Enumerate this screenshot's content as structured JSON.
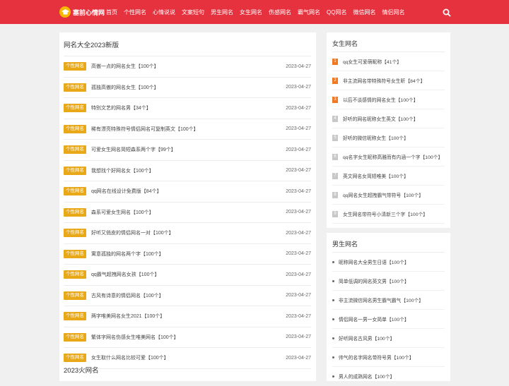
{
  "site": {
    "logo_text": "塞前心情网"
  },
  "nav": [
    "首页",
    "个性网名",
    "心情说说",
    "文案短句",
    "男生网名",
    "女生网名",
    "伤感网名",
    "霸气网名",
    "QQ网名",
    "微信网名",
    "情侣网名"
  ],
  "main": {
    "title": "网名大全2023新版",
    "tag": "个性网名",
    "rows": [
      {
        "title": "高傲一点的网名女生【100个】",
        "date": "2023-04-27"
      },
      {
        "title": "孤独高傲的网名女生【100个】",
        "date": "2023-04-27"
      },
      {
        "title": "特别文艺的网名男【34个】",
        "date": "2023-04-27"
      },
      {
        "title": "稀有漂亮特殊符号情侣网名可复制英文【100个】",
        "date": "2023-04-27"
      },
      {
        "title": "可爱女生网名简短森系两个字【99个】",
        "date": "2023-04-27"
      },
      {
        "title": "我想找个好网名女【100个】",
        "date": "2023-04-27"
      },
      {
        "title": "qq网名在线设计免费版【84个】",
        "date": "2023-04-27"
      },
      {
        "title": "森系可爱女生网名【100个】",
        "date": "2023-04-27"
      },
      {
        "title": "好听又俏皮的情侣网名一对【100个】",
        "date": "2023-04-27"
      },
      {
        "title": "寓意孤独的网名两个字【100个】",
        "date": "2023-04-27"
      },
      {
        "title": "qq霸气超拽网名女孩【100个】",
        "date": "2023-04-27"
      },
      {
        "title": "古风有诗意的情侣网名【100个】",
        "date": "2023-04-27"
      },
      {
        "title": "两字唯美网名女生2021【100个】",
        "date": "2023-04-27"
      },
      {
        "title": "繁体字网名伤感女生唯美网名【100个】",
        "date": "2023-04-27"
      },
      {
        "title": "女生取什么网名比较可爱【100个】",
        "date": "2023-04-27"
      }
    ],
    "section2_title": "2023火网名"
  },
  "sidebar_female": {
    "title": "女生网名",
    "items": [
      {
        "num": "1",
        "text": "qq女生可爱萌昵称【41个】"
      },
      {
        "num": "2",
        "text": "非主流网名带特殊符号女生昕【84个】"
      },
      {
        "num": "3",
        "text": "以后不谈感情的网名女生【100个】"
      },
      {
        "num": "4",
        "text": "好听的网名昵称女生英文【100个】"
      },
      {
        "num": "5",
        "text": "好听的微信昵称女生【100个】"
      },
      {
        "num": "6",
        "text": "qq名字女生昵称高雅而有内涵一个字【100个】"
      },
      {
        "num": "7",
        "text": "英文网名女简短唯美【100个】"
      },
      {
        "num": "8",
        "text": "qq网名女生超拽霸气带符号【100个】"
      },
      {
        "num": "9",
        "text": "女生网名带符号小清新三个字【100个】"
      }
    ]
  },
  "sidebar_male": {
    "title": "男生网名",
    "items": [
      "昵称网名大全男生日语【100个】",
      "简单低调的网名英文男【100个】",
      "非主流微信网名男生霸气霸气【100个】",
      "情侣网名一男一女简单【100个】",
      "好听网名古风男【100个】",
      "帅气的名字网名带符号男【100个】",
      "男人的成熟网名【100个】"
    ]
  },
  "colors": {
    "brand": "#e5323e",
    "tag": "#e9a818",
    "rank_hot": "#f07a23",
    "rank": "#c8c8c8"
  },
  "icons": {
    "search": "search-icon",
    "logo": "graduation-cap-icon"
  }
}
